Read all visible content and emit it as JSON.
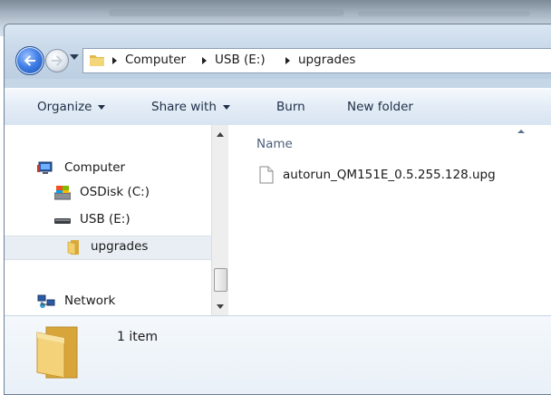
{
  "window": {
    "address": {
      "breadcrumbs": [
        "Computer",
        "USB (E:)",
        "upgrades"
      ]
    }
  },
  "toolbar": {
    "organize": "Organize",
    "share_with": "Share with",
    "burn": "Burn",
    "new_folder": "New folder"
  },
  "nav": {
    "items": [
      {
        "label": "Computer",
        "icon": "computer-icon"
      },
      {
        "label": "OSDisk (C:)",
        "icon": "hard-disk-icon"
      },
      {
        "label": "USB (E:)",
        "icon": "usb-drive-icon"
      },
      {
        "label": "upgrades",
        "icon": "folder-icon",
        "selected": true
      },
      {
        "label": "Network",
        "icon": "network-icon"
      }
    ]
  },
  "filelist": {
    "column_name": "Name",
    "files": [
      {
        "name": "autorun_QM151E_0.5.255.128.upg",
        "icon": "file-icon"
      }
    ]
  },
  "details": {
    "item_count": "1 item"
  },
  "colors": {
    "accent": "#3f7ee6",
    "folder": "#e8c15a",
    "selection": "#e8eef4"
  }
}
